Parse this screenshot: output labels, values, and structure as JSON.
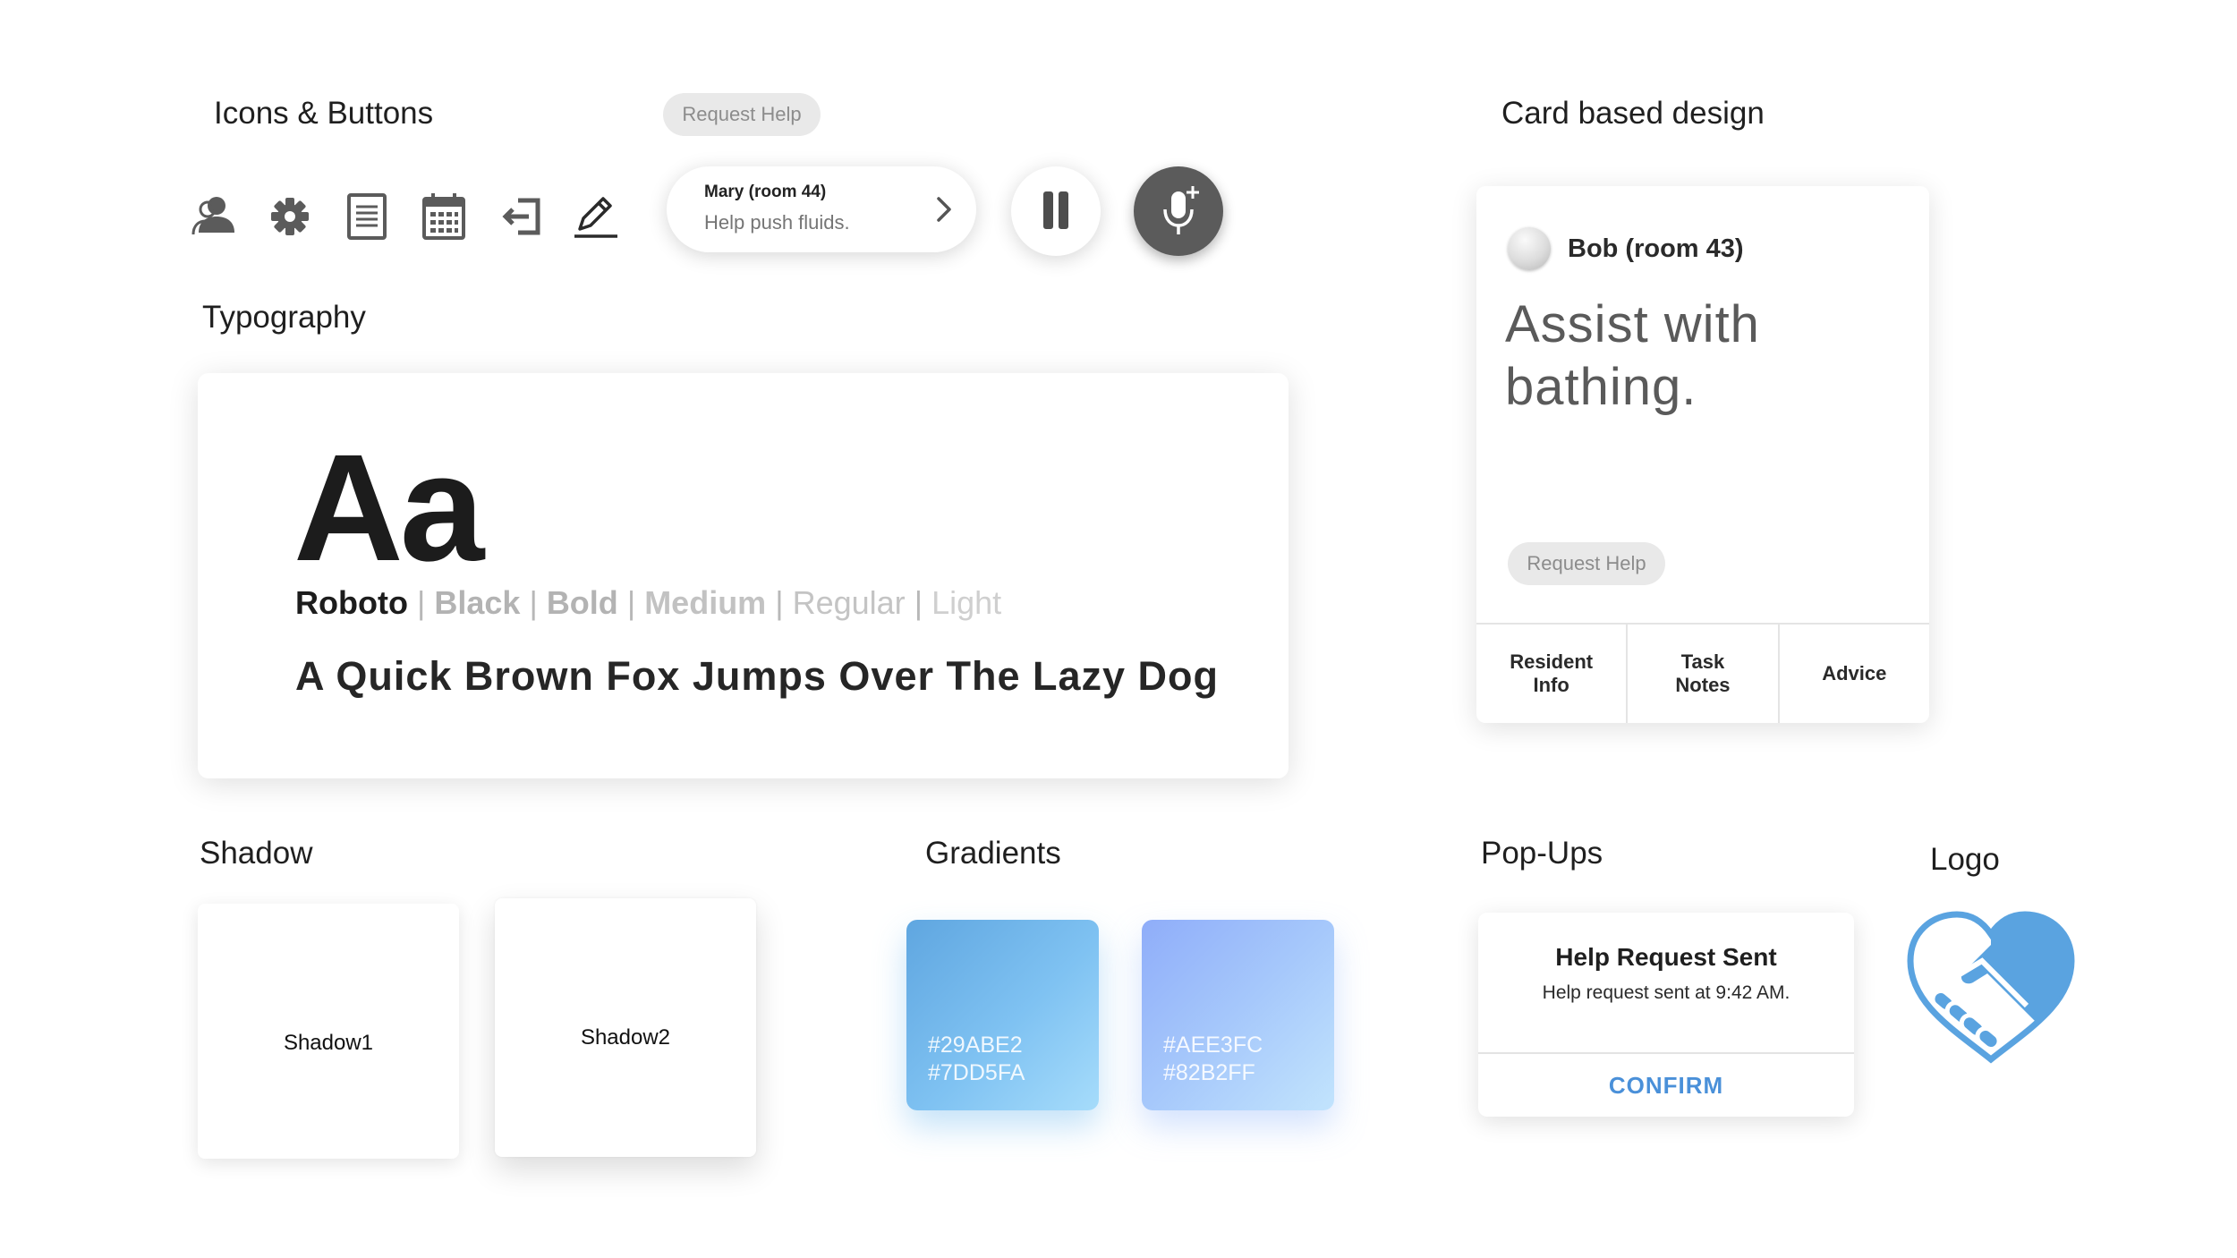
{
  "sections": {
    "icons_buttons": "Icons & Buttons",
    "card_design": "Card based design",
    "typography": "Typography",
    "shadow": "Shadow",
    "gradients": "Gradients",
    "popups": "Pop-Ups",
    "logo": "Logo"
  },
  "icons": [
    "person-icon",
    "gear-icon",
    "document-icon",
    "calendar-icon",
    "logout-icon",
    "pencil-icon"
  ],
  "request_help_chip": "Request Help",
  "mary_card": {
    "name": "Mary (room 44)",
    "message": "Help push fluids."
  },
  "typography": {
    "sample_large": "Aa",
    "font_name": "Roboto",
    "weights": [
      "Black",
      "Bold",
      "Medium",
      "Regular",
      "Light"
    ],
    "separator": "|",
    "sample_sentence": "A Quick Brown Fox Jumps Over The Lazy Dog"
  },
  "bob_card": {
    "name": "Bob (room 43)",
    "task": "Assist with bathing.",
    "chip": "Request Help",
    "tabs": [
      "Resident\nInfo",
      "Task\nNotes",
      "Advice"
    ]
  },
  "shadows": [
    "Shadow1",
    "Shadow2"
  ],
  "gradients": [
    {
      "color1": "#29ABE2",
      "color2": "#7DD5FA",
      "label1": "#29ABE2",
      "label2": "#7DD5FA"
    },
    {
      "color1": "#AEE3FC",
      "color2": "#82B2FF",
      "label1": "#AEE3FC",
      "label2": "#82B2FF"
    }
  ],
  "popup": {
    "title": "Help Request Sent",
    "message": "Help request sent at 9:42 AM.",
    "button": "CONFIRM"
  },
  "colors": {
    "accent_blue": "#4A90D9",
    "logo_blue": "#5AA3E0",
    "icon_gray": "#5b5b5b"
  }
}
